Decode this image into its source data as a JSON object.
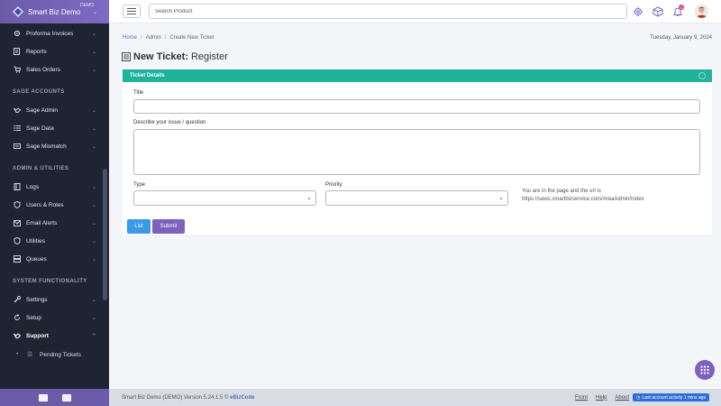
{
  "brand": {
    "name": "Smart Biz Demo",
    "tag": "DEMO"
  },
  "sidebar": {
    "items_top": [
      {
        "label": "Proforma Invoices",
        "icon": "settings-icon"
      },
      {
        "label": "Reports",
        "icon": "file-icon"
      },
      {
        "label": "Sales Orders",
        "icon": "cart-icon"
      }
    ],
    "sections": [
      {
        "title": "SAGE ACCOUNTS",
        "items": [
          "Sage Admin",
          "Sage Data",
          "Sage Mismatch"
        ]
      },
      {
        "title": "ADMIN & UTILITIES",
        "items": [
          "Logs",
          "Users & Roles",
          "Email Alerts",
          "Utilities",
          "Queues"
        ]
      },
      {
        "title": "SYSTEM FUNCTIONALITY",
        "items": [
          "Settings",
          "Setup",
          "Support"
        ]
      }
    ],
    "sub_item": "Pending Tickets"
  },
  "topbar": {
    "search_placeholder": "Search Product",
    "notification_count": "3"
  },
  "breadcrumb": {
    "home": "Home",
    "admin": "Admin",
    "current": "Create New Ticket"
  },
  "date": "Tuesday, January 9, 2024",
  "page": {
    "title_strong": "New Ticket:",
    "title_rest": "Register"
  },
  "card": {
    "header": "Ticket Details",
    "title_label": "Title",
    "describe_label": "Describe your issue / question",
    "type_label": "Type",
    "priority_label": "Priority",
    "info_line1": "You are in the page and the url is",
    "info_line2": "https://saws.smartbizservice.com/AreaAdmin/Index"
  },
  "buttons": {
    "list": "List",
    "submit": "Submit"
  },
  "footer": {
    "version_text": "Smart Biz Demo (DEMO) Version 5.24.1.5 ©",
    "vendor": "eBizCode",
    "links": [
      "Front",
      "Help",
      "About"
    ],
    "activity": "Last account activity  1 mins ago"
  },
  "colors": {
    "brand": "#6b5ba8",
    "sidebar": "#1f2433",
    "teal": "#1fb39b",
    "list": "#3a9ae8",
    "submit": "#7c61bf"
  }
}
